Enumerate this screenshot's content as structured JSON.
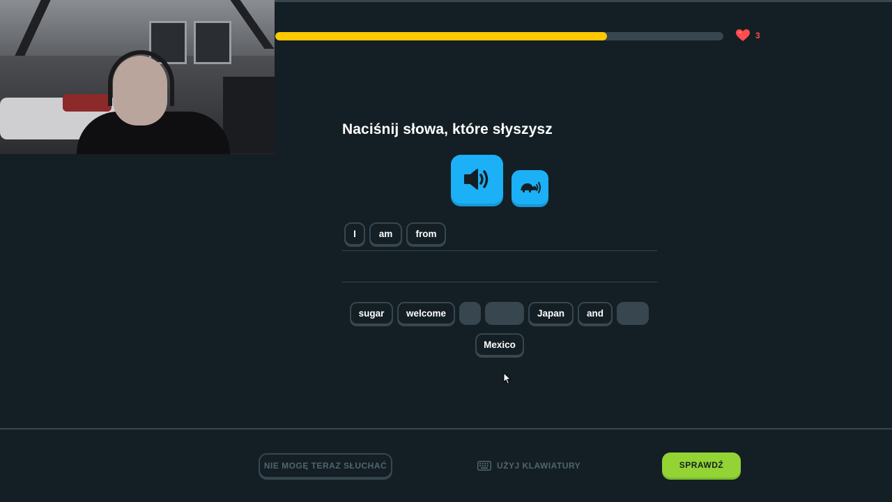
{
  "lesson": {
    "progress": 0.74,
    "hearts": "3",
    "title": "Naciśnij słowa, które słyszysz"
  },
  "audio": {
    "play_icon": "speaker-icon",
    "slow_icon": "turtle-icon"
  },
  "answer": {
    "selected": [
      "I",
      "am",
      "from"
    ]
  },
  "word_bank": {
    "w1": "sugar",
    "w2": "welcome",
    "w5": "Japan",
    "w6": "and",
    "w8": "Mexico"
  },
  "footer": {
    "cant_listen": "NIE MOGĘ TERAZ SŁUCHAĆ",
    "use_keyboard": "UŻYJ KLAWIATURY",
    "check": "SPRAWDŹ"
  },
  "colors": {
    "background": "#131f24",
    "progress": "#ffc800",
    "heart": "#ff4b4b",
    "audio": "#1cb0f6",
    "check": "#93d333",
    "border": "#37464f"
  }
}
